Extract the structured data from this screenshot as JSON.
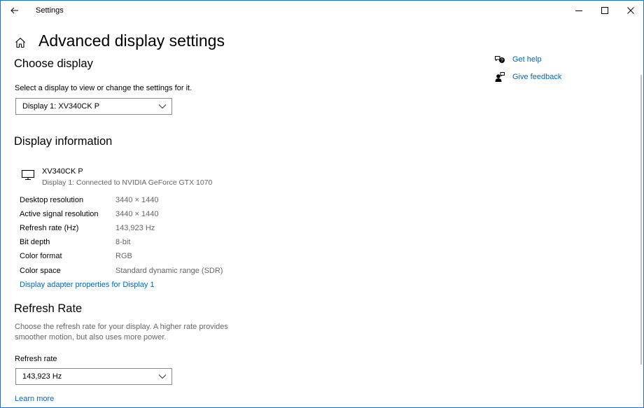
{
  "window": {
    "title": "Settings"
  },
  "header": {
    "title": "Advanced display settings"
  },
  "choose_display": {
    "heading": "Choose display",
    "description": "Select a display to view or change the settings for it.",
    "selected_display": "Display 1: XV340CK P"
  },
  "display_info": {
    "heading": "Display information",
    "monitor_name": "XV340CK P",
    "monitor_subtitle": "Display 1: Connected to NVIDIA GeForce GTX 1070",
    "rows": [
      {
        "label": "Desktop resolution",
        "value": "3440 × 1440"
      },
      {
        "label": "Active signal resolution",
        "value": "3440 × 1440"
      },
      {
        "label": "Refresh rate (Hz)",
        "value": "143,923 Hz"
      },
      {
        "label": "Bit depth",
        "value": "8-bit"
      },
      {
        "label": "Color format",
        "value": "RGB"
      },
      {
        "label": "Color space",
        "value": "Standard dynamic range (SDR)"
      }
    ],
    "adapter_link": "Display adapter properties for Display 1"
  },
  "refresh_rate": {
    "heading": "Refresh Rate",
    "description_line1": "Choose the refresh rate for your display. A higher rate provides",
    "description_line2": "smoother motion, but also uses more power.",
    "field_label": "Refresh rate",
    "selected_rate": "143,923 Hz",
    "learn_more": "Learn more"
  },
  "side_links": {
    "get_help": "Get help",
    "give_feedback": "Give feedback"
  },
  "icons": {
    "back": "back-arrow-icon",
    "home": "home-icon",
    "minimize": "minimize-icon",
    "maximize": "maximize-icon",
    "close": "close-icon",
    "monitor": "monitor-icon",
    "chevron": "chevron-down-icon",
    "help": "help-chat-icon",
    "feedback": "feedback-person-icon"
  },
  "colors": {
    "link": "#0067c0",
    "secondary_text": "#666666",
    "window_border": "#1f6fc3"
  }
}
